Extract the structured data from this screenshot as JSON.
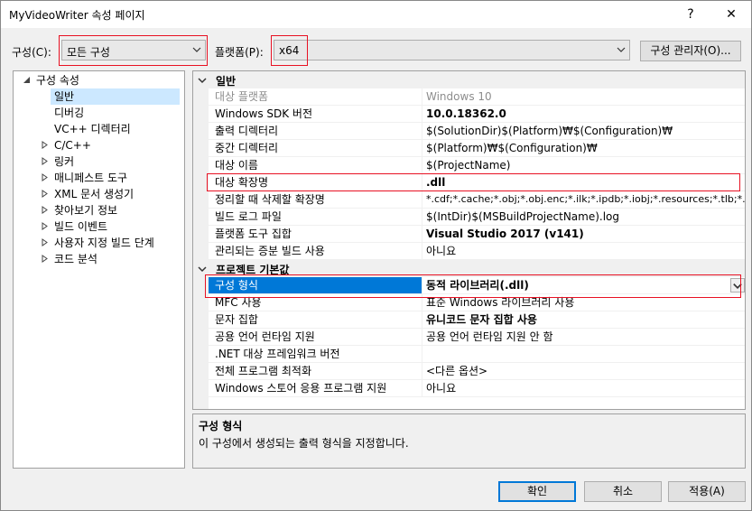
{
  "window": {
    "title": "MyVideoWriter 속성 페이지",
    "help_label": "?",
    "close_label": "✕"
  },
  "toolbar": {
    "config_label": "구성(C):",
    "config_value": "모든 구성",
    "platform_label": "플랫폼(P):",
    "platform_value": "x64",
    "config_manager_label": "구성 관리자(O)..."
  },
  "tree": {
    "root_label": "구성 속성",
    "items": [
      {
        "label": "일반",
        "expandable": false,
        "selected": true
      },
      {
        "label": "디버깅",
        "expandable": false
      },
      {
        "label": "VC++ 디렉터리",
        "expandable": false
      },
      {
        "label": "C/C++",
        "expandable": true
      },
      {
        "label": "링커",
        "expandable": true
      },
      {
        "label": "매니페스트 도구",
        "expandable": true
      },
      {
        "label": "XML 문서 생성기",
        "expandable": true
      },
      {
        "label": "찾아보기 정보",
        "expandable": true
      },
      {
        "label": "빌드 이벤트",
        "expandable": true
      },
      {
        "label": "사용자 지정 빌드 단계",
        "expandable": true
      },
      {
        "label": "코드 분석",
        "expandable": true
      }
    ]
  },
  "grid": {
    "general": {
      "title": "일반",
      "rows": [
        {
          "name": "대상 플랫폼",
          "value": "Windows 10",
          "disabled": true
        },
        {
          "name": "Windows SDK 버전",
          "value": "10.0.18362.0",
          "bold": true
        },
        {
          "name": "출력 디렉터리",
          "value": "$(SolutionDir)$(Platform)₩$(Configuration)₩"
        },
        {
          "name": "중간 디렉터리",
          "value": "$(Platform)₩$(Configuration)₩"
        },
        {
          "name": "대상 이름",
          "value": "$(ProjectName)"
        },
        {
          "name": "대상 확장명",
          "value": ".dll",
          "bold": true
        },
        {
          "name": "정리할 때 삭제할 확장명",
          "value": "*.cdf;*.cache;*.obj;*.obj.enc;*.ilk;*.ipdb;*.iobj;*.resources;*.tlb;*.tli;*.t"
        },
        {
          "name": "빌드 로그 파일",
          "value": "$(IntDir)$(MSBuildProjectName).log"
        },
        {
          "name": "플랫폼 도구 집합",
          "value": "Visual Studio 2017 (v141)",
          "bold": true
        },
        {
          "name": "관리되는 증분 빌드 사용",
          "value": "아니요"
        }
      ]
    },
    "defaults": {
      "title": "프로젝트 기본값",
      "rows": [
        {
          "name": "구성 형식",
          "value": "동적 라이브러리(.dll)",
          "bold": true,
          "selected": true
        },
        {
          "name": "MFC 사용",
          "value": "표준 Windows 라이브러리 사용"
        },
        {
          "name": "문자 집합",
          "value": "유니코드 문자 집합 사용",
          "bold": true
        },
        {
          "name": "공용 언어 런타임 지원",
          "value": "공용 언어 런타임 지원 안 함"
        },
        {
          "name": ".NET 대상 프레임워크 버전",
          "value": ""
        },
        {
          "name": "전체 프로그램 최적화",
          "value": "<다른 옵션>"
        },
        {
          "name": "Windows 스토어 응용 프로그램 지원",
          "value": "아니요"
        }
      ]
    }
  },
  "description": {
    "title": "구성 형식",
    "text": "이 구성에서 생성되는 출력 형식을 지정합니다."
  },
  "buttons": {
    "ok": "확인",
    "cancel": "취소",
    "apply": "적용(A)"
  },
  "colors": {
    "selection": "#0078d7",
    "highlight_box": "#e81123",
    "tree_selection": "#cce8ff"
  }
}
